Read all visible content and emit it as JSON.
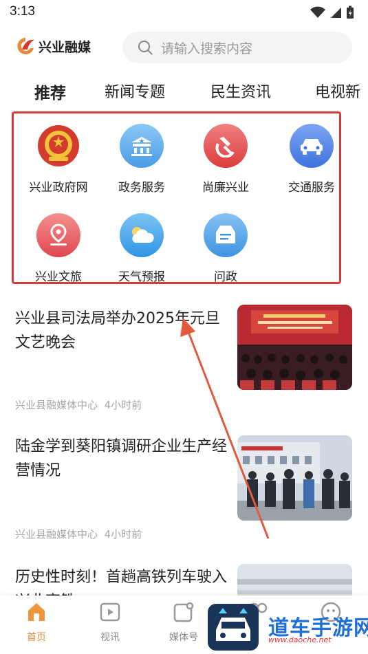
{
  "status": {
    "time": "3:13"
  },
  "header": {
    "logo_text": "兴业融媒",
    "search_placeholder": "请输入搜索内容"
  },
  "tabs": [
    {
      "label": "推荐",
      "active": true
    },
    {
      "label": "新闻专题"
    },
    {
      "label": "民生资讯"
    },
    {
      "label": "电视新"
    }
  ],
  "services": [
    {
      "label": "兴业政府网",
      "icon": "national-emblem-icon",
      "color": "#d33b2c"
    },
    {
      "label": "政务服务",
      "icon": "government-building-icon",
      "color": "#5aa9ea"
    },
    {
      "label": "尚廉兴业",
      "icon": "party-emblem-icon",
      "color": "#e24a4a"
    },
    {
      "label": "交通服务",
      "icon": "car-icon",
      "color": "#4d84e8"
    },
    {
      "label": "兴业文旅",
      "icon": "map-pin-icon",
      "color": "#e5575e"
    },
    {
      "label": "天气预报",
      "icon": "weather-cloud-icon",
      "color": "#3fa4e8"
    },
    {
      "label": "问政",
      "icon": "inbox-doc-icon",
      "color": "#4aa0e6"
    }
  ],
  "news": [
    {
      "title": "兴业县司法局举办2025年元旦文艺晚会",
      "source": "兴业县融媒体中心",
      "time": "4小时前"
    },
    {
      "title": "陆金学到葵阳镇调研企业生产经营情况",
      "source": "兴业县融媒体中心",
      "time": "4小时前"
    },
    {
      "title": "历史性时刻！首趟高铁列车驶入兴业高铁",
      "source": "",
      "time": ""
    }
  ],
  "bottom_nav": [
    {
      "label": "首页",
      "icon": "home-icon",
      "active": true
    },
    {
      "label": "视讯",
      "icon": "video-play-icon"
    },
    {
      "label": "媒体号",
      "icon": "media-account-icon"
    },
    {
      "label": "",
      "icon": "service-icon"
    },
    {
      "label": "",
      "icon": "profile-icon"
    }
  ],
  "watermark": {
    "text": "道车手游网",
    "sub": "www.daoche.net"
  },
  "colors": {
    "accent": "#e8893a",
    "highlight_border": "#d93a3a",
    "arrow": "#e05a3c"
  }
}
